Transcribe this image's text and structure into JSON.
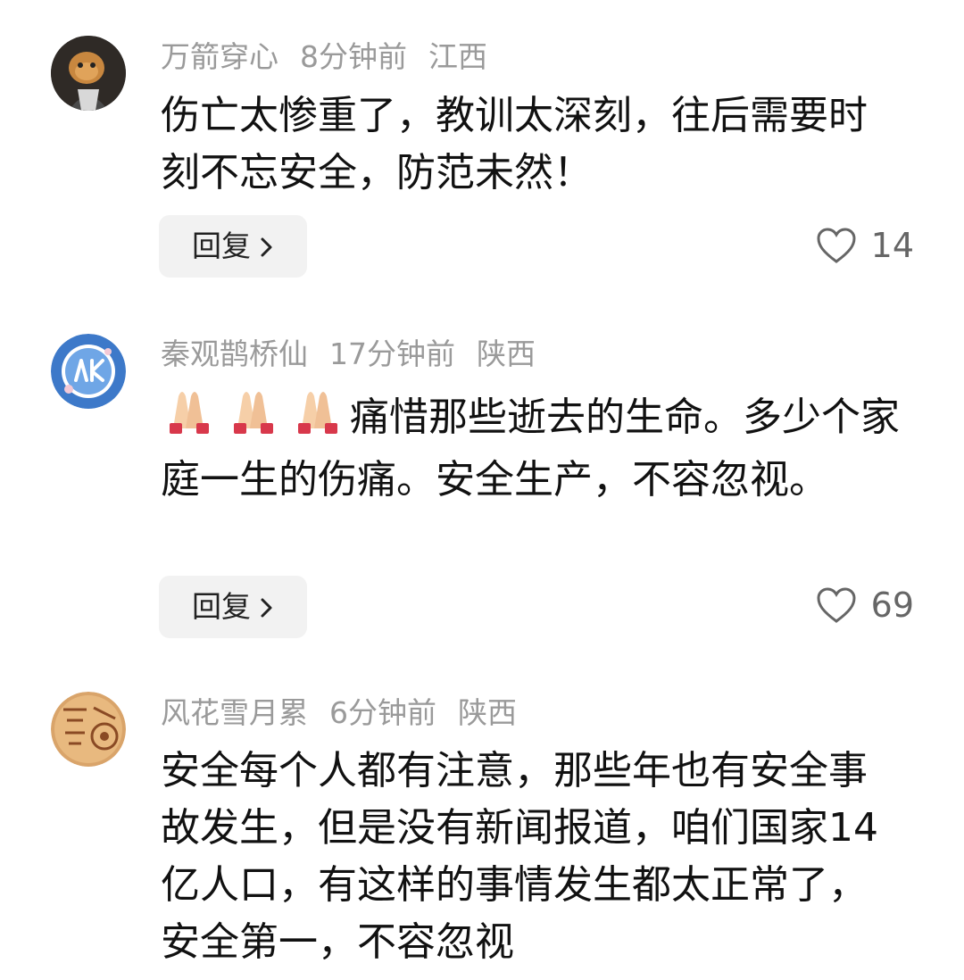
{
  "comments": [
    {
      "user": "万箭穿心",
      "time": "8分钟前",
      "region": "江西",
      "text": "伤亡太惨重了，教训太深刻，往后需要时刻不忘安全，防范未然！",
      "reply_label": "回复",
      "likes": "14"
    },
    {
      "user": "秦观鹊桥仙",
      "time": "17分钟前",
      "region": "陕西",
      "text": "痛惜那些逝去的生命。多少个家庭一生的伤痛。安全生产，不容忽视。",
      "reply_label": "回复",
      "likes": "69"
    },
    {
      "user": "风花雪月累",
      "time": "6分钟前",
      "region": "陕西",
      "text": "安全每个人都有注意，那些年也有安全事故发生，但是没有新闻报道，咱们国家14亿人口，有这样的事情发生都太正常了，安全第一，不容忽视"
    }
  ],
  "icons": {
    "reply_chevron": "chevron-right-icon",
    "like": "heart-outline-icon",
    "pray": "folded-hands-emoji"
  },
  "colors": {
    "meta_text": "#9a9a9a",
    "body_text": "#111111",
    "reply_bg": "#f2f2f2"
  }
}
